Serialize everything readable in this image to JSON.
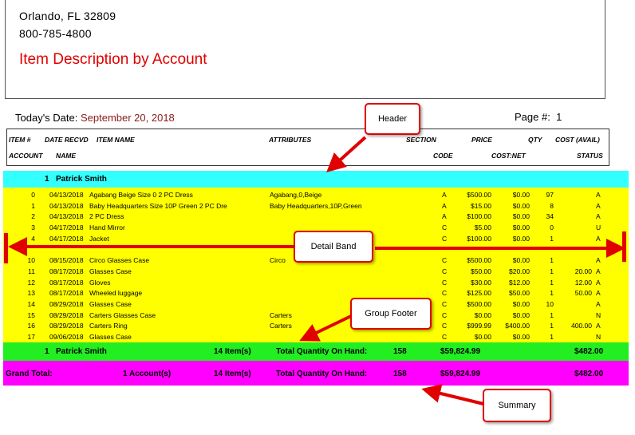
{
  "company": {
    "address_line": "Orlando, FL 32809",
    "phone": "800-785-4800",
    "report_title": "Item Description by Account"
  },
  "meta": {
    "date_label": "Today's Date:",
    "date_value": "September 20, 2018",
    "page_label": "Page #:",
    "page_value": "1"
  },
  "columns": {
    "item": "ITEM #",
    "date": "DATE RECVD",
    "item_name": "ITEM NAME",
    "attributes": "ATTRIBUTES",
    "section": "SECTION",
    "price": "PRICE",
    "qty": "QTY",
    "cost_avail": "COST (AVAIL)",
    "account": "ACCOUNT",
    "name": "NAME",
    "code": "CODE",
    "cost_net": "COST:NET",
    "status": "STATUS"
  },
  "group": {
    "account": "1",
    "name": "Patrick Smith"
  },
  "rows": [
    {
      "item": "0",
      "date": "04/13/2018",
      "name": "Agabang Beige Size 0 2 PC Dress",
      "attr": "Agabang,0,Beige",
      "code": "A",
      "price": "$500.00",
      "net": "$0.00",
      "qty": "97",
      "avail": "",
      "status": "A"
    },
    {
      "item": "1",
      "date": "04/13/2018",
      "name": "Baby Headquarters Size 10P Green 2 PC Dre",
      "attr": "Baby Headquarters,10P,Green",
      "code": "A",
      "price": "$15.00",
      "net": "$0.00",
      "qty": "8",
      "avail": "",
      "status": "A"
    },
    {
      "item": "2",
      "date": "04/13/2018",
      "name": "2 PC Dress",
      "attr": "",
      "code": "A",
      "price": "$100.00",
      "net": "$0.00",
      "qty": "34",
      "avail": "",
      "status": "A"
    },
    {
      "item": "3",
      "date": "04/17/2018",
      "name": "Hand Mirror",
      "attr": "",
      "code": "C",
      "price": "$5.00",
      "net": "$0.00",
      "qty": "0",
      "avail": "",
      "status": "U"
    },
    {
      "item": "4",
      "date": "04/17/2018",
      "name": "Jacket",
      "attr": "",
      "code": "C",
      "price": "$100.00",
      "net": "$0.00",
      "qty": "1",
      "avail": "",
      "status": "A"
    },
    {
      "item": "10",
      "date": "08/15/2018",
      "name": "Circo Glasses Case",
      "attr": "Circo",
      "code": "C",
      "price": "$500.00",
      "net": "$0.00",
      "qty": "1",
      "avail": "",
      "status": "A"
    },
    {
      "item": "11",
      "date": "08/17/2018",
      "name": "Glasses Case",
      "attr": "",
      "code": "C",
      "price": "$50.00",
      "net": "$20.00",
      "qty": "1",
      "avail": "20.00",
      "status": "A"
    },
    {
      "item": "12",
      "date": "08/17/2018",
      "name": "Gloves",
      "attr": "",
      "code": "C",
      "price": "$30.00",
      "net": "$12.00",
      "qty": "1",
      "avail": "12.00",
      "status": "A"
    },
    {
      "item": "13",
      "date": "08/17/2018",
      "name": "Wheeled luggage",
      "attr": "",
      "code": "C",
      "price": "$125.00",
      "net": "$50.00",
      "qty": "1",
      "avail": "50.00",
      "status": "A"
    },
    {
      "item": "14",
      "date": "08/29/2018",
      "name": "Glasses Case",
      "attr": "",
      "code": "C",
      "price": "$500.00",
      "net": "$0.00",
      "qty": "10",
      "avail": "",
      "status": "A"
    },
    {
      "item": "15",
      "date": "08/29/2018",
      "name": "Carters Glasses Case",
      "attr": "Carters",
      "code": "C",
      "price": "$0.00",
      "net": "$0.00",
      "qty": "1",
      "avail": "",
      "status": "N"
    },
    {
      "item": "16",
      "date": "08/29/2018",
      "name": "Carters Ring",
      "attr": "Carters",
      "code": "C",
      "price": "$999.99",
      "net": "$400.00",
      "qty": "1",
      "avail": "400.00",
      "status": "A"
    },
    {
      "item": "17",
      "date": "09/06/2018",
      "name": "Glasses Case",
      "attr": "",
      "code": "C",
      "price": "$0.00",
      "net": "$0.00",
      "qty": "1",
      "avail": "",
      "status": "N"
    }
  ],
  "group_footer": {
    "account": "1",
    "name": "Patrick Smith",
    "items": "14 Item(s)",
    "qty_label": "Total Quantity On Hand:",
    "qty": "158",
    "total": "$59,824.99",
    "avail": "$482.00"
  },
  "summary": {
    "label": "Grand Total:",
    "accounts": "1  Account(s)",
    "items": "14 Item(s)",
    "qty_label": "Total Quantity On Hand:",
    "qty": "158",
    "total": "$59,824.99",
    "avail": "$482.00"
  },
  "callouts": {
    "header": "Header",
    "detail": "Detail Band",
    "group_footer": "Group Footer",
    "summary": "Summary"
  },
  "colors": {
    "title_red": "#e00000",
    "group_band": "#33ffff",
    "detail_band": "#ffff00",
    "footer_band": "#22ee22",
    "summary_band": "#ff00ff"
  }
}
